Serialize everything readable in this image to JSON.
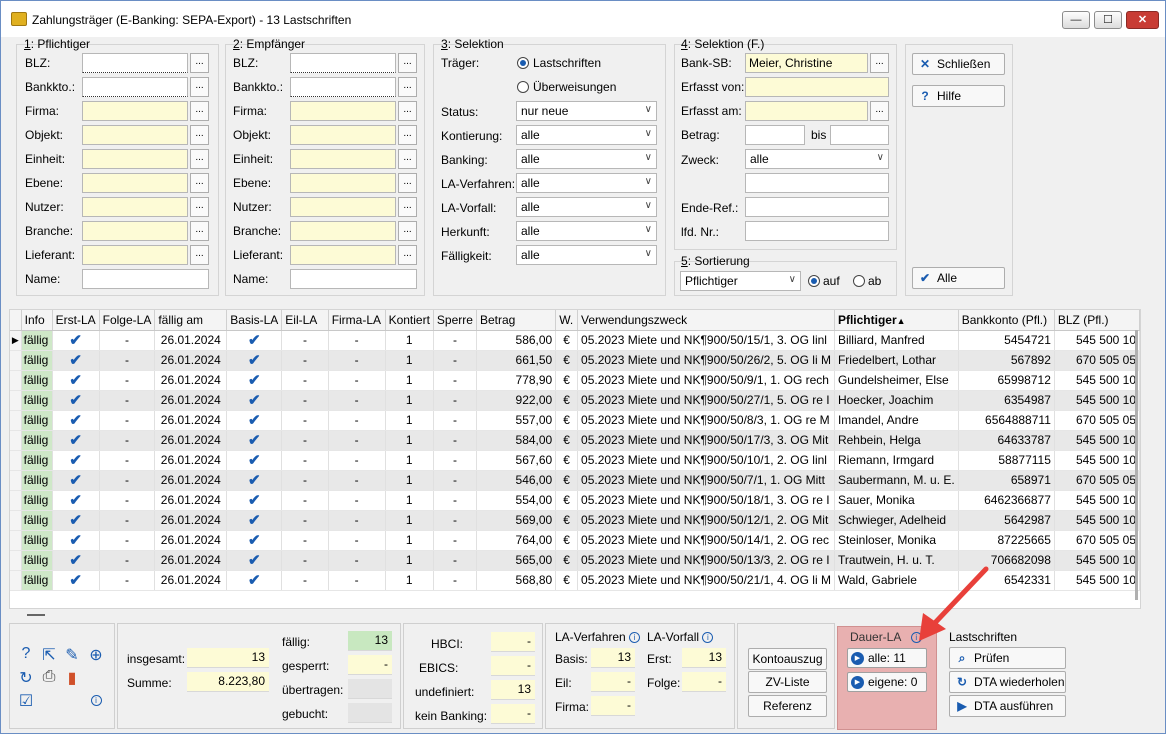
{
  "window": {
    "title": "Zahlungsträger (E-Banking: SEPA-Export) - 13 Lastschriften",
    "min": "—",
    "max": "☐",
    "close": "✕"
  },
  "group1": {
    "num": "1",
    "title": ": Pflichtiger",
    "fields": [
      "BLZ:",
      "Bankkto.:",
      "Firma:",
      "Objekt:",
      "Einheit:",
      "Ebene:",
      "Nutzer:",
      "Branche:",
      "Lieferant:",
      "Name:"
    ]
  },
  "group2": {
    "num": "2",
    "title": ": Empfänger",
    "fields": [
      "BLZ:",
      "Bankkto.:",
      "Firma:",
      "Objekt:",
      "Einheit:",
      "Ebene:",
      "Nutzer:",
      "Branche:",
      "Lieferant:",
      "Name:"
    ]
  },
  "group3": {
    "num": "3",
    "title": ": Selektion",
    "traeger_label": "Träger:",
    "radio1": "Lastschriften",
    "radio2": "Überweisungen",
    "rows": [
      {
        "label": "Status:",
        "value": "nur neue"
      },
      {
        "label": "Kontierung:",
        "value": "alle"
      },
      {
        "label": "Banking:",
        "value": "alle"
      },
      {
        "label": "LA-Verfahren:",
        "value": "alle"
      },
      {
        "label": "LA-Vorfall:",
        "value": "alle"
      },
      {
        "label": "Herkunft:",
        "value": "alle"
      },
      {
        "label": "Fälligkeit:",
        "value": "alle"
      }
    ]
  },
  "group4": {
    "num": "4",
    "title": ": Selektion (F.)",
    "bank_sb_label": "Bank-SB:",
    "bank_sb_value": "Meier, Christine",
    "erfasst_von": "Erfasst von:",
    "erfasst_am": "Erfasst am:",
    "betrag": "Betrag:",
    "bis": "bis",
    "zweck": "Zweck:",
    "zweck_value": "alle",
    "ende_ref": "Ende-Ref.:",
    "lfd_nr": "lfd. Nr.:"
  },
  "group5": {
    "num": "5",
    "title": ": Sortierung",
    "value": "Pflichtiger",
    "auf": "auf",
    "ab": "ab"
  },
  "buttons": {
    "schliessen": "Schließen",
    "hilfe": "Hilfe",
    "alle": "Alle"
  },
  "grid": {
    "columns": [
      "Info",
      "Erst-LA",
      "Folge-LA",
      "fällig am",
      "Basis-LA",
      "Eil-LA",
      "Firma-LA",
      "Kontiert",
      "Sperre",
      "Betrag",
      "W.",
      "Verwendungszweck",
      "Pflichtiger",
      "Bankkonto (Pfl.)",
      "BLZ (Pfl.)"
    ],
    "rows": [
      {
        "info": "fällig",
        "folge": "-",
        "date": "26.01.2024",
        "eil": "-",
        "firma": "-",
        "kont": "1",
        "sperre": "-",
        "betrag": "586,00",
        "w": "€",
        "zweck": "05.2023 Miete und NK¶900/50/15/1, 3. OG linl",
        "pfl": "Billiard, Manfred",
        "konto": "5454721",
        "blz": "545 500 10"
      },
      {
        "info": "fällig",
        "folge": "-",
        "date": "26.01.2024",
        "eil": "-",
        "firma": "-",
        "kont": "1",
        "sperre": "-",
        "betrag": "661,50",
        "w": "€",
        "zweck": "05.2023 Miete und NK¶900/50/26/2, 5. OG li M",
        "pfl": "Friedelbert, Lothar",
        "konto": "567892",
        "blz": "670 505 05"
      },
      {
        "info": "fällig",
        "folge": "-",
        "date": "26.01.2024",
        "eil": "-",
        "firma": "-",
        "kont": "1",
        "sperre": "-",
        "betrag": "778,90",
        "w": "€",
        "zweck": "05.2023 Miete und NK¶900/50/9/1, 1. OG rech",
        "pfl": "Gundelsheimer, Else",
        "konto": "65998712",
        "blz": "545 500 10"
      },
      {
        "info": "fällig",
        "folge": "-",
        "date": "26.01.2024",
        "eil": "-",
        "firma": "-",
        "kont": "1",
        "sperre": "-",
        "betrag": "922,00",
        "w": "€",
        "zweck": "05.2023 Miete und NK¶900/50/27/1, 5. OG re I",
        "pfl": "Hoecker, Joachim",
        "konto": "6354987",
        "blz": "545 500 10"
      },
      {
        "info": "fällig",
        "folge": "-",
        "date": "26.01.2024",
        "eil": "-",
        "firma": "-",
        "kont": "1",
        "sperre": "-",
        "betrag": "557,00",
        "w": "€",
        "zweck": "05.2023 Miete und NK¶900/50/8/3, 1. OG re M",
        "pfl": "Imandel, Andre",
        "konto": "6564888711",
        "blz": "670 505 05"
      },
      {
        "info": "fällig",
        "folge": "-",
        "date": "26.01.2024",
        "eil": "-",
        "firma": "-",
        "kont": "1",
        "sperre": "-",
        "betrag": "584,00",
        "w": "€",
        "zweck": "05.2023 Miete und NK¶900/50/17/3, 3. OG Mit",
        "pfl": "Rehbein, Helga",
        "konto": "64633787",
        "blz": "545 500 10"
      },
      {
        "info": "fällig",
        "folge": "-",
        "date": "26.01.2024",
        "eil": "-",
        "firma": "-",
        "kont": "1",
        "sperre": "-",
        "betrag": "567,60",
        "w": "€",
        "zweck": "05.2023 Miete und NK¶900/50/10/1, 2. OG linl",
        "pfl": "Riemann, Irmgard",
        "konto": "58877115",
        "blz": "545 500 10"
      },
      {
        "info": "fällig",
        "folge": "-",
        "date": "26.01.2024",
        "eil": "-",
        "firma": "-",
        "kont": "1",
        "sperre": "-",
        "betrag": "546,00",
        "w": "€",
        "zweck": "05.2023 Miete und NK¶900/50/7/1, 1. OG Mitt",
        "pfl": "Saubermann, M. u. E.",
        "konto": "658971",
        "blz": "670 505 05"
      },
      {
        "info": "fällig",
        "folge": "-",
        "date": "26.01.2024",
        "eil": "-",
        "firma": "-",
        "kont": "1",
        "sperre": "-",
        "betrag": "554,00",
        "w": "€",
        "zweck": "05.2023 Miete und NK¶900/50/18/1, 3. OG re I",
        "pfl": "Sauer, Monika",
        "konto": "6462366877",
        "blz": "545 500 10"
      },
      {
        "info": "fällig",
        "folge": "-",
        "date": "26.01.2024",
        "eil": "-",
        "firma": "-",
        "kont": "1",
        "sperre": "-",
        "betrag": "569,00",
        "w": "€",
        "zweck": "05.2023 Miete und NK¶900/50/12/1, 2. OG Mit",
        "pfl": "Schwieger, Adelheid",
        "konto": "5642987",
        "blz": "545 500 10"
      },
      {
        "info": "fällig",
        "folge": "-",
        "date": "26.01.2024",
        "eil": "-",
        "firma": "-",
        "kont": "1",
        "sperre": "-",
        "betrag": "764,00",
        "w": "€",
        "zweck": "05.2023 Miete und NK¶900/50/14/1, 2. OG rec",
        "pfl": "Steinloser, Monika",
        "konto": "87225665",
        "blz": "670 505 05"
      },
      {
        "info": "fällig",
        "folge": "-",
        "date": "26.01.2024",
        "eil": "-",
        "firma": "-",
        "kont": "1",
        "sperre": "-",
        "betrag": "565,00",
        "w": "€",
        "zweck": "05.2023 Miete und NK¶900/50/13/3, 2. OG re I",
        "pfl": "Trautwein, H. u. T.",
        "konto": "706682098",
        "blz": "545 500 10"
      },
      {
        "info": "fällig",
        "folge": "-",
        "date": "26.01.2024",
        "eil": "-",
        "firma": "-",
        "kont": "1",
        "sperre": "-",
        "betrag": "568,80",
        "w": "€",
        "zweck": "05.2023 Miete und NK¶900/50/21/1, 4. OG li M",
        "pfl": "Wald, Gabriele",
        "konto": "6542331",
        "blz": "545 500 10"
      }
    ]
  },
  "summary": {
    "insgesamt_label": "insgesamt:",
    "insgesamt": "13",
    "summe_label": "Summe:",
    "summe": "8.223,80",
    "faellig_label": "fällig:",
    "faellig": "13",
    "gesperrt_label": "gesperrt:",
    "gesperrt": "-",
    "uebertragen_label": "übertragen:",
    "uebertragen": "",
    "gebucht_label": "gebucht:",
    "gebucht": ""
  },
  "banking": {
    "hbci_label": "HBCI:",
    "hbci": "-",
    "ebics_label": "EBICS:",
    "ebics": "-",
    "undef_label": "undefiniert:",
    "undef": "13",
    "kein_label": "kein Banking:",
    "kein": "-"
  },
  "la": {
    "verfahren_title": "LA-Verfahren",
    "vorfall_title": "LA-Vorfall",
    "basis_label": "Basis:",
    "basis": "13",
    "eil_label": "Eil:",
    "eil": "-",
    "firma_label": "Firma:",
    "firma": "-",
    "erst_label": "Erst:",
    "erst": "13",
    "folge_label": "Folge:",
    "folge": "-"
  },
  "actions": {
    "kontoauszug": "Kontoauszug",
    "zv_liste": "ZV-Liste",
    "referenz": "Referenz"
  },
  "dauer": {
    "title": "Dauer-LA",
    "alle": "alle: 11",
    "eigene": "eigene: 0"
  },
  "lastschriften": {
    "title": "Lastschriften",
    "pruefen": "Prüfen",
    "wiederholen": "DTA wiederholen",
    "ausfuehren": "DTA ausführen"
  },
  "colors": {
    "accent": "#1a5cb0",
    "yellow": "#fdfbd6",
    "green": "#cfe8c8",
    "dauer_bg": "#e8b0b0",
    "arrow": "#e8403a"
  }
}
